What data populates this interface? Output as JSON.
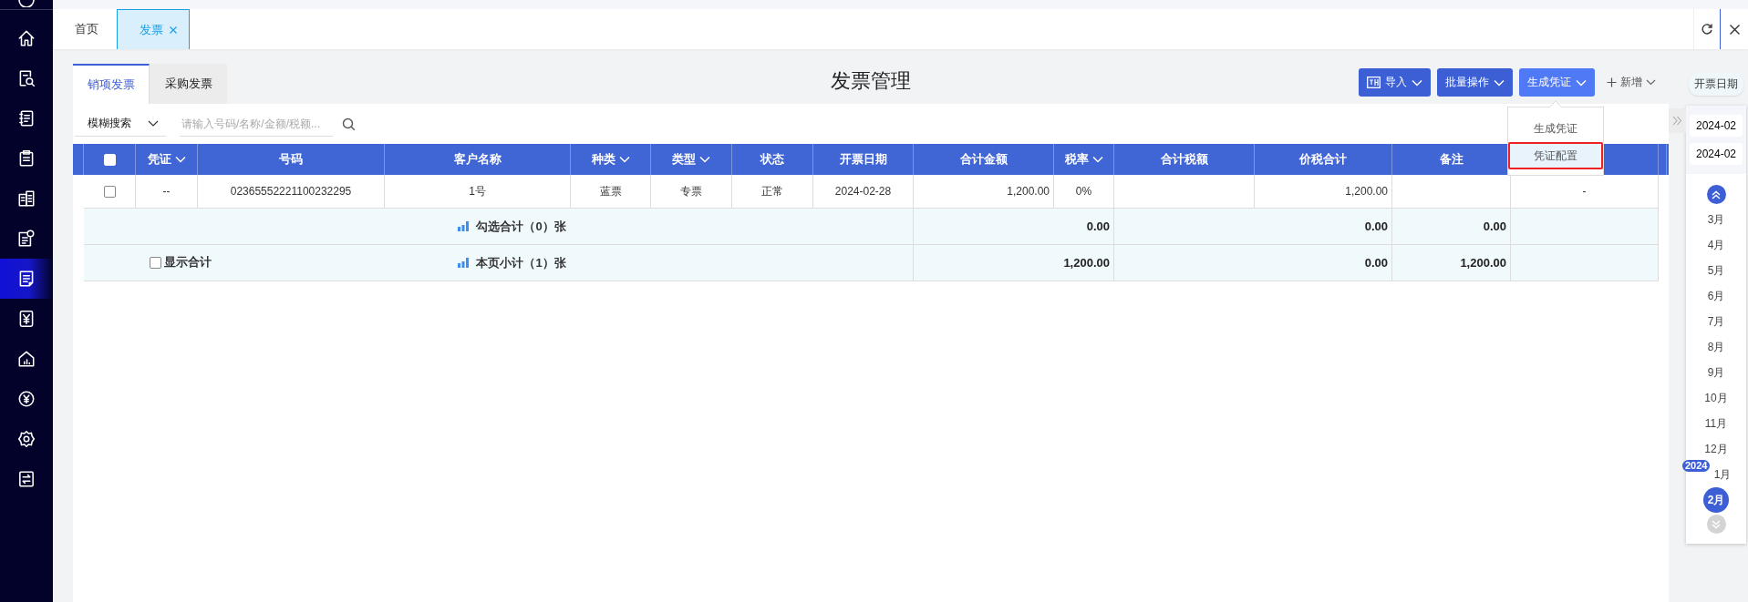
{
  "sidebar": {
    "items": [
      {
        "selected": false
      },
      {
        "selected": false
      },
      {
        "selected": false
      },
      {
        "selected": false
      },
      {
        "selected": false
      },
      {
        "selected": false
      },
      {
        "selected": true
      },
      {
        "selected": false
      },
      {
        "selected": false
      },
      {
        "selected": false
      },
      {
        "selected": false
      },
      {
        "selected": false
      }
    ]
  },
  "tabs": [
    {
      "label": "首页",
      "selected": false,
      "closable": false
    },
    {
      "label": "发票",
      "selected": true,
      "closable": true
    }
  ],
  "page_title": "发票管理",
  "invoice_tabs": [
    {
      "label": "销项发票",
      "selected": true
    },
    {
      "label": "采购发票",
      "selected": false
    }
  ],
  "search": {
    "mode": "模糊搜索",
    "placeholder": "请输入号码/名称/金额/税额..."
  },
  "actions": [
    {
      "label": "导入",
      "kind": "icon-primary",
      "expanded": false
    },
    {
      "label": "批量操作",
      "kind": "primary",
      "expanded": false
    },
    {
      "label": "生成凭证",
      "kind": "primary",
      "expanded": true
    },
    {
      "label": "新增",
      "kind": "add"
    }
  ],
  "dropdown": {
    "items": [
      {
        "label": "生成凭证",
        "selected": false,
        "outlined": false
      },
      {
        "label": "凭证配置",
        "selected": true,
        "outlined": true
      }
    ]
  },
  "table": {
    "select_all_checked": false,
    "columns": [
      {
        "label": "凭证",
        "filter": true,
        "kind": "text"
      },
      {
        "label": "号码",
        "filter": false,
        "kind": "text"
      },
      {
        "label": "客户名称",
        "filter": false,
        "kind": "text"
      },
      {
        "label": "种类",
        "filter": true,
        "kind": "text"
      },
      {
        "label": "类型",
        "filter": true,
        "kind": "text"
      },
      {
        "label": "状态",
        "filter": false,
        "kind": "text"
      },
      {
        "label": "开票日期",
        "filter": false,
        "kind": "text"
      },
      {
        "label": "合计金额",
        "filter": false,
        "kind": "amount"
      },
      {
        "label": "税率",
        "filter": true,
        "kind": "text"
      },
      {
        "label": "合计税额",
        "filter": false,
        "kind": "amount"
      },
      {
        "label": "价税合计",
        "filter": false,
        "kind": "amount"
      },
      {
        "label": "备注",
        "filter": false,
        "kind": "text"
      },
      {
        "kind": "text"
      }
    ],
    "rows": [
      {
        "checked": false,
        "cells": [
          "--",
          "02365552221100232295",
          "1号",
          "蓝票",
          "专票",
          "正常",
          "2024-02-28",
          "1,200.00",
          "0%",
          null,
          "1,200.00",
          null,
          "-"
        ]
      }
    ],
    "summary_rows": [
      {
        "label": "勾选合计（0）张",
        "totals": [
          "0.00",
          "0.00",
          "0.00"
        ]
      },
      {
        "label": "本页小计（1）张",
        "totals": [
          "1,200.00",
          "0.00",
          "1,200.00"
        ],
        "toggle": {
          "label": "显示合计",
          "checked": false
        }
      }
    ]
  },
  "date_panel": {
    "tooltip": "开票日期",
    "range": [
      "2024-02",
      "2024-02"
    ],
    "year_badge": "2024",
    "can_scroll_up": true,
    "can_scroll_down": false,
    "months": [
      {
        "label": "3月",
        "selected": false
      },
      {
        "label": "4月",
        "selected": false
      },
      {
        "label": "5月",
        "selected": false
      },
      {
        "label": "6月",
        "selected": false
      },
      {
        "label": "7月",
        "selected": false
      },
      {
        "label": "8月",
        "selected": false
      },
      {
        "label": "9月",
        "selected": false
      },
      {
        "label": "10月",
        "selected": false
      },
      {
        "label": "11月",
        "selected": false
      },
      {
        "label": "12月",
        "selected": false
      },
      {
        "label": "1月",
        "selected": false
      },
      {
        "label": "2月",
        "selected": true
      }
    ]
  }
}
